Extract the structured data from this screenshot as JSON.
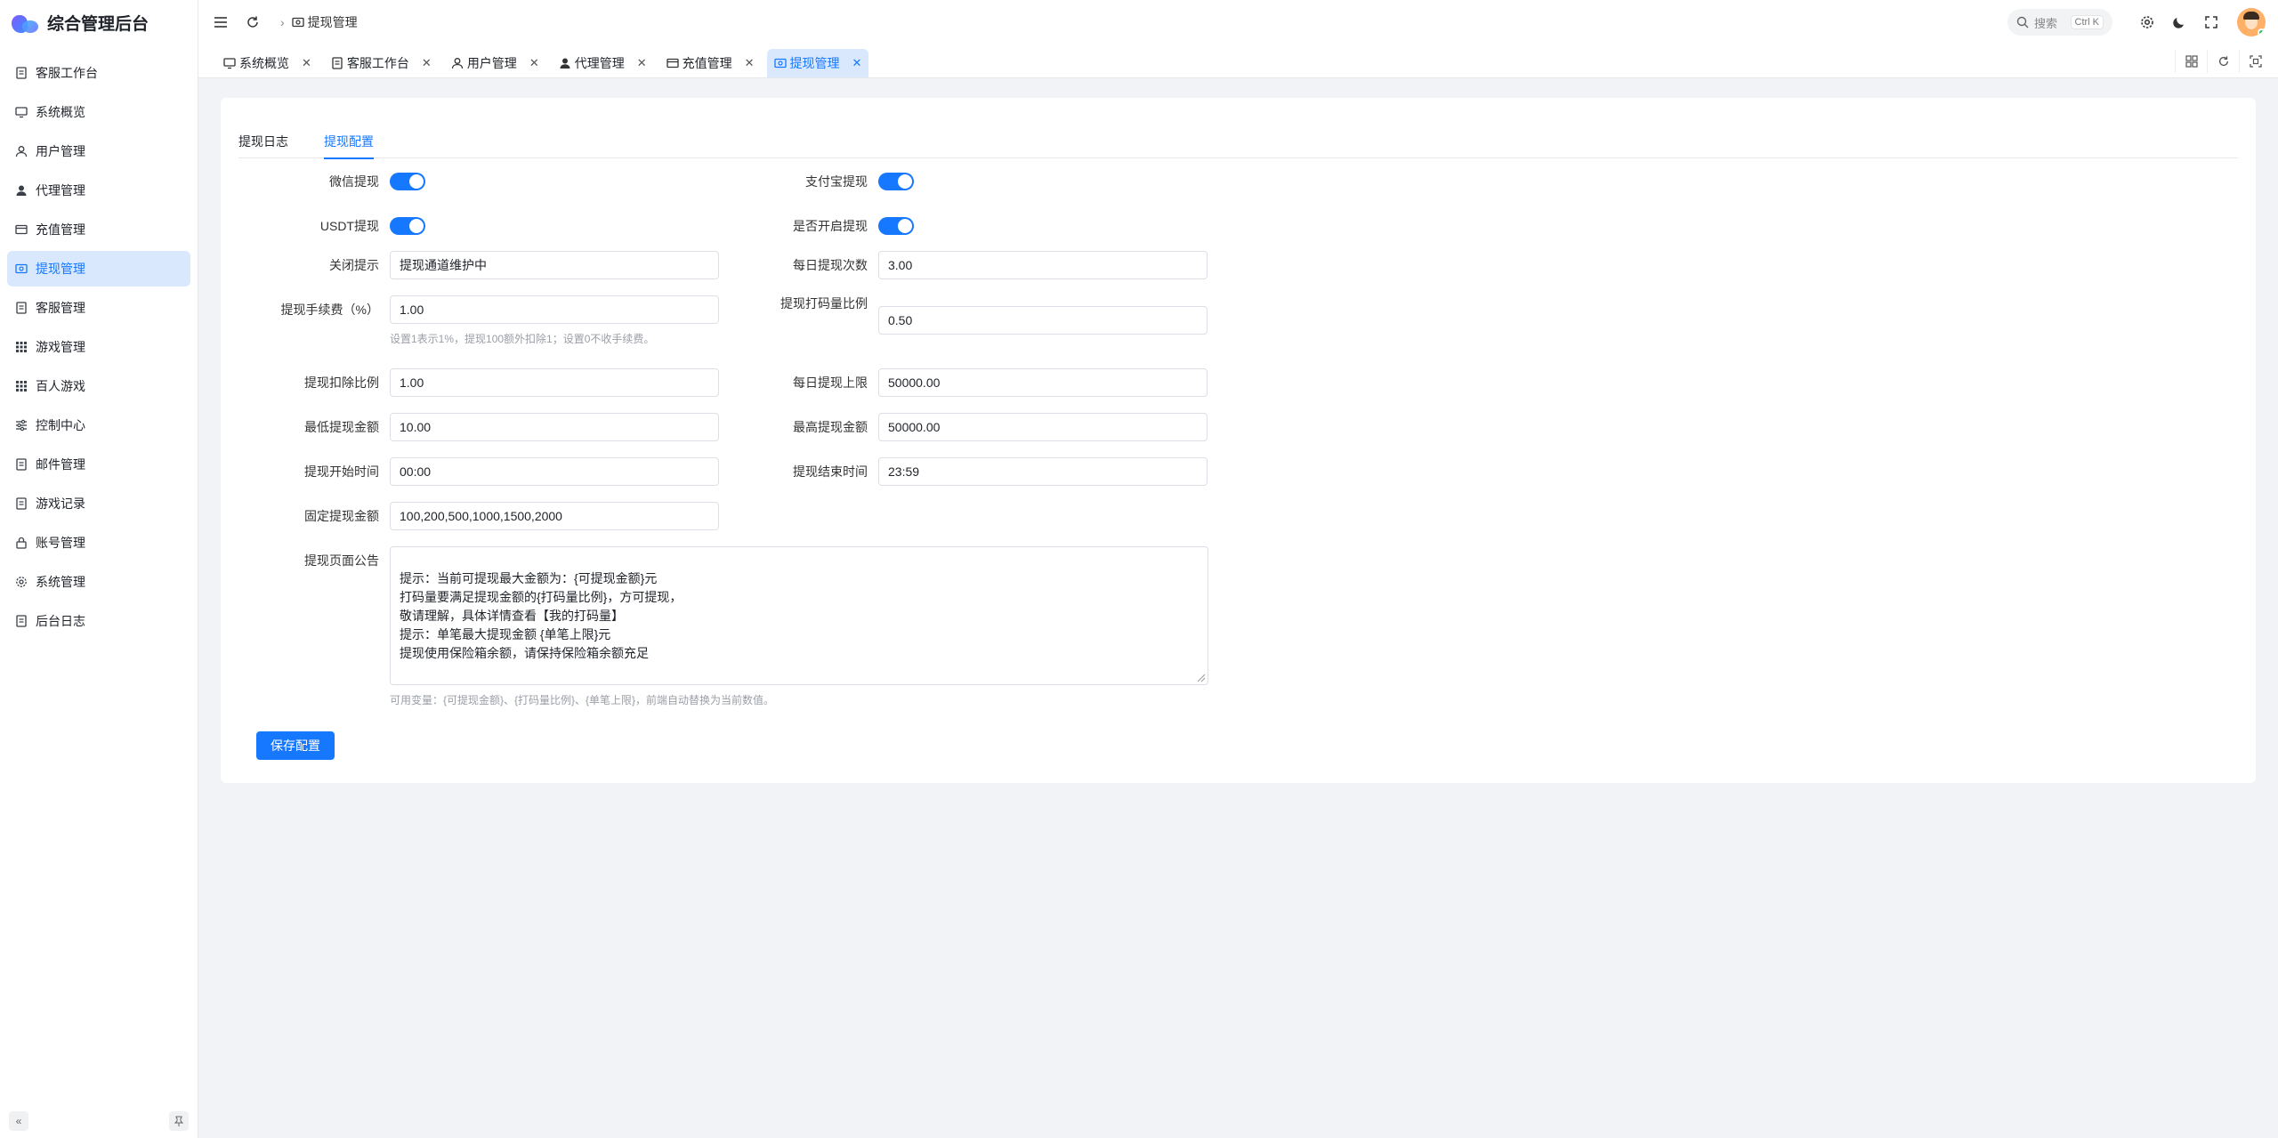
{
  "app": {
    "title": "综合管理后台"
  },
  "sidebar": {
    "items": [
      {
        "label": "客服工作台"
      },
      {
        "label": "系统概览"
      },
      {
        "label": "用户管理"
      },
      {
        "label": "代理管理"
      },
      {
        "label": "充值管理"
      },
      {
        "label": "提现管理"
      },
      {
        "label": "客服管理"
      },
      {
        "label": "游戏管理"
      },
      {
        "label": "百人游戏"
      },
      {
        "label": "控制中心"
      },
      {
        "label": "邮件管理"
      },
      {
        "label": "游戏记录"
      },
      {
        "label": "账号管理"
      },
      {
        "label": "系统管理"
      },
      {
        "label": "后台日志"
      }
    ]
  },
  "header": {
    "breadcrumb": "提现管理",
    "search_placeholder": "搜索",
    "search_shortcut": "Ctrl K"
  },
  "tabs": [
    {
      "label": "系统概览"
    },
    {
      "label": "客服工作台"
    },
    {
      "label": "用户管理"
    },
    {
      "label": "代理管理"
    },
    {
      "label": "充值管理"
    },
    {
      "label": "提现管理"
    }
  ],
  "subtabs": {
    "log": "提现日志",
    "config": "提现配置"
  },
  "form": {
    "wechat": {
      "label": "微信提现",
      "enabled": true
    },
    "alipay": {
      "label": "支付宝提现",
      "enabled": true
    },
    "usdt": {
      "label": "USDT提现",
      "enabled": true
    },
    "open": {
      "label": "是否开启提现",
      "enabled": true
    },
    "close_tip": {
      "label": "关闭提示",
      "value": "提现通道维护中"
    },
    "daily_count": {
      "label": "每日提现次数",
      "value": "3.00"
    },
    "fee": {
      "label": "提现手续费（%）",
      "value": "1.00",
      "hint": "设置1表示1%，提现100额外扣除1；设置0不收手续费。"
    },
    "bet_ratio": {
      "label": "提现打码量比例",
      "value": "0.50"
    },
    "deduct_ratio": {
      "label": "提现扣除比例",
      "value": "1.00"
    },
    "daily_limit": {
      "label": "每日提现上限",
      "value": "50000.00"
    },
    "min_amount": {
      "label": "最低提现金额",
      "value": "10.00"
    },
    "max_amount": {
      "label": "最高提现金额",
      "value": "50000.00"
    },
    "start_time": {
      "label": "提现开始时间",
      "value": "00:00"
    },
    "end_time": {
      "label": "提现结束时间",
      "value": "23:59"
    },
    "fixed_amounts": {
      "label": "固定提现金额",
      "value": "100,200,500,1000,1500,2000"
    },
    "notice": {
      "label": "提现页面公告",
      "value": "提示：当前可提现最大金额为：{可提现金额}元\n打码量要满足提现金额的{打码量比例}，方可提现，\n敬请理解，具体详情查看【我的打码量】\n提示：单笔最大提现金额 {单笔上限}元\n提现使用保险箱余额，请保持保险箱余额充足",
      "hint": "可用变量：{可提现金额}、{打码量比例}、{单笔上限}，前端自动替换为当前数值。"
    },
    "save_label": "保存配置"
  }
}
